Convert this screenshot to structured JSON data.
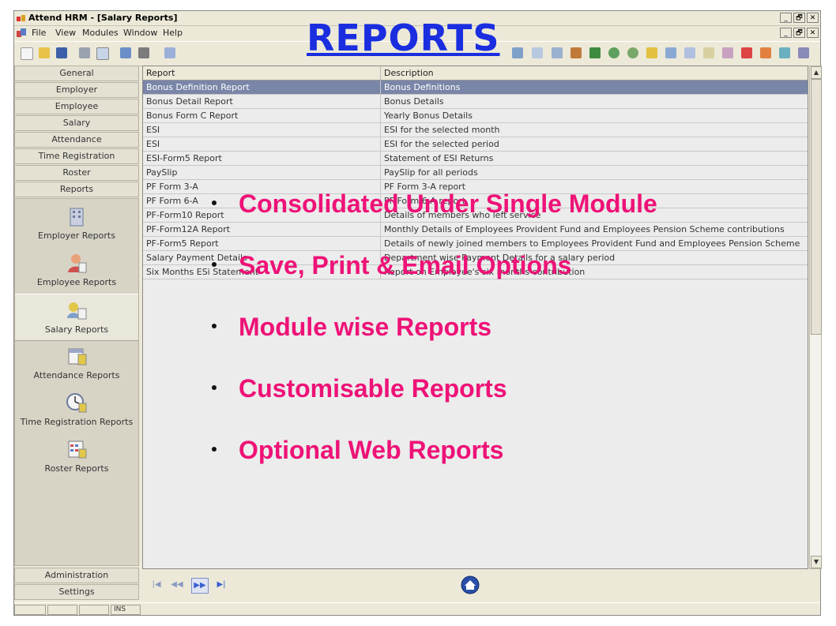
{
  "window": {
    "title": "Attend HRM - [Salary Reports]",
    "controls": [
      "_",
      "🗗",
      "✕"
    ]
  },
  "menu": {
    "items": [
      "File",
      "View",
      "Modules",
      "Window",
      "Help"
    ]
  },
  "left_nav": {
    "top_buttons": [
      "General",
      "Employer",
      "Employee",
      "Salary",
      "Attendance",
      "Time Registration",
      "Roster",
      "Reports"
    ],
    "sub_items": [
      {
        "label": "Employer Reports",
        "icon": "building-icon"
      },
      {
        "label": "Employee Reports",
        "icon": "person-icon"
      },
      {
        "label": "Salary Reports",
        "icon": "salary-icon"
      },
      {
        "label": "Attendance Reports",
        "icon": "calendar-icon"
      },
      {
        "label": "Time Registration Reports",
        "icon": "clock-icon"
      },
      {
        "label": "Roster Reports",
        "icon": "roster-icon"
      }
    ],
    "selected_sub_item": "Salary Reports",
    "bottom_buttons": [
      "Administration",
      "Settings"
    ]
  },
  "grid": {
    "columns": [
      "Report",
      "Description"
    ],
    "selected_row": 0,
    "rows": [
      [
        "Bonus Definition Report",
        "Bonus Definitions"
      ],
      [
        "Bonus Detail Report",
        "Bonus Details"
      ],
      [
        "Bonus Form C Report",
        "Yearly Bonus Details"
      ],
      [
        "ESI",
        "ESI for the selected month"
      ],
      [
        "ESI",
        "ESI for the selected period"
      ],
      [
        "ESI-Form5 Report",
        "Statement of ESI Returns"
      ],
      [
        "PaySlip",
        "PaySlip for all periods"
      ],
      [
        "PF Form 3-A",
        "PF Form 3-A report"
      ],
      [
        "PF Form 6-A",
        "PF Form 6-A report"
      ],
      [
        "PF-Form10 Report",
        "Details of members who left service"
      ],
      [
        "PF-Form12A Report",
        "Monthly Details of Employees Provident Fund and Employees Pension Scheme contributions"
      ],
      [
        "PF-Form5 Report",
        "Details of newly joined members to Employees Provident Fund and Employees Pension Scheme"
      ],
      [
        "Salary Payment Details",
        "Department wise Payment Details for a salary period"
      ],
      [
        "Six Months ESi Statement",
        "Report on Employee's six months contribution"
      ]
    ]
  },
  "pager": {
    "buttons": [
      "|◀",
      "◀◀",
      "▶▶",
      "▶|"
    ]
  },
  "statusbar": {
    "mode": "INS"
  },
  "overlay": {
    "title": "REPORTS",
    "bullets": [
      "Consolidated Under Single Module",
      "Save, Print & Email Options",
      "Module wise Reports",
      "Customisable Reports",
      "Optional Web Reports"
    ]
  },
  "colors": {
    "title": "#1a2ee0",
    "bullets": "#ee1277",
    "selection": "#7a86a8"
  }
}
